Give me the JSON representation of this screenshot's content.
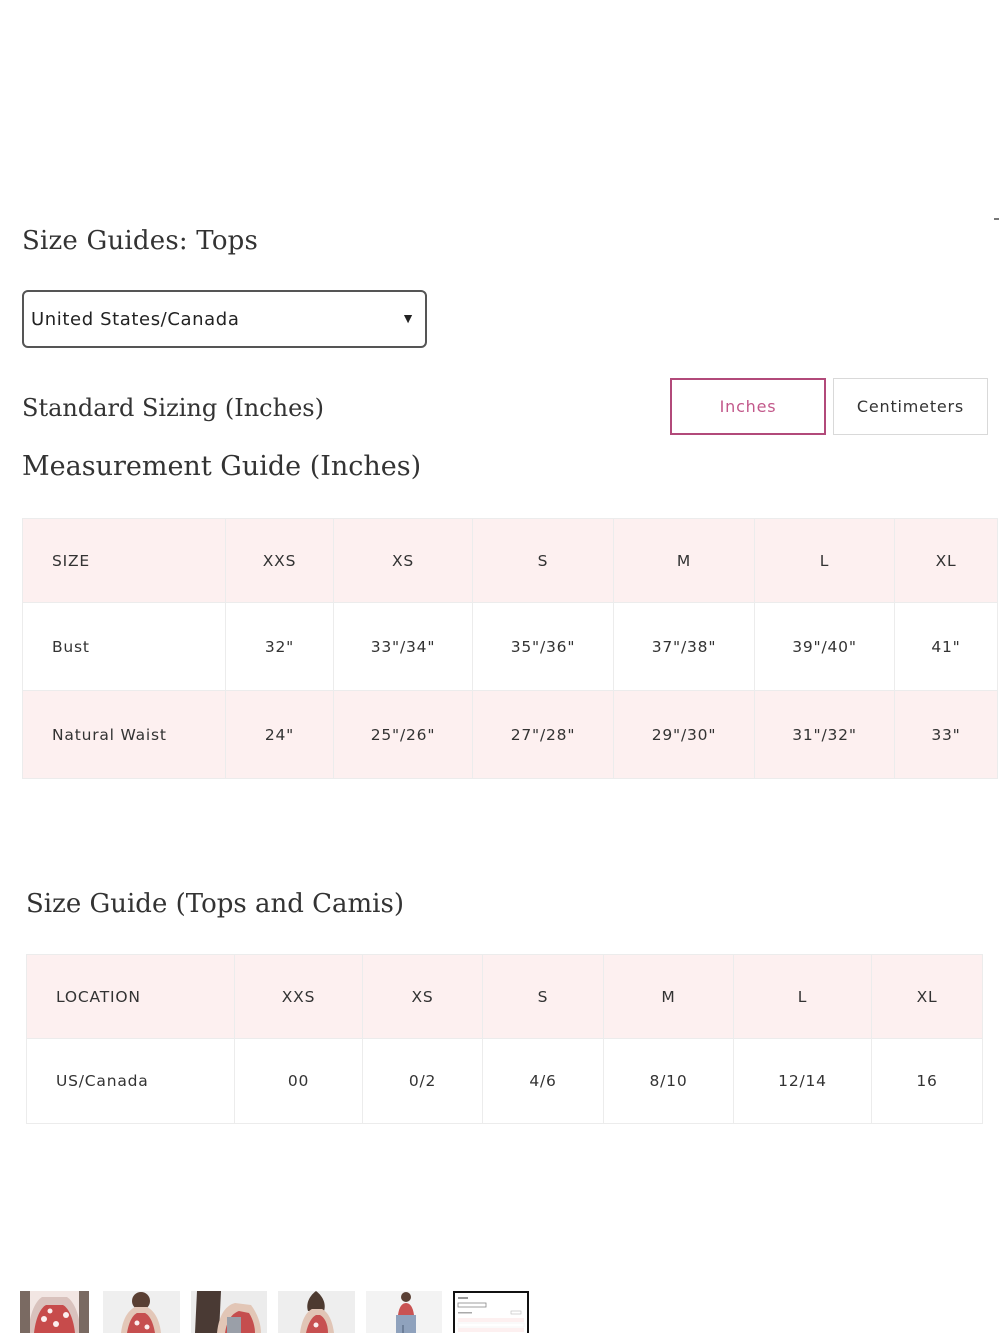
{
  "title": "Size Guides: Tops",
  "region_select": {
    "value": "United States/Canada",
    "caret": "▼"
  },
  "standard_heading": "Standard Sizing (Inches)",
  "unit_toggle": {
    "inches": "Inches",
    "centimeters": "Centimeters",
    "active": "Inches",
    "active_color": "#c2588a"
  },
  "measurement": {
    "heading": "Measurement Guide (Inches)",
    "header": [
      "SIZE",
      "XXS",
      "XS",
      "S",
      "M",
      "L",
      "XL"
    ],
    "rows": [
      [
        "Bust",
        "32\"",
        "33\"/34\"",
        "35\"/36\"",
        "37\"/38\"",
        "39\"/40\"",
        "41\""
      ],
      [
        "Natural Waist",
        "24\"",
        "25\"/26\"",
        "27\"/28\"",
        "29\"/30\"",
        "31\"/32\"",
        "33\""
      ]
    ]
  },
  "size_guide": {
    "heading": "Size Guide (Tops and Camis)",
    "header": [
      "LOCATION",
      "XXS",
      "XS",
      "S",
      "M",
      "L",
      "XL"
    ],
    "rows": [
      [
        "US/Canada",
        "00",
        "0/2",
        "4/6",
        "8/10",
        "12/14",
        "16"
      ]
    ]
  },
  "colors": {
    "header_row_bg": "#fdf0f0",
    "accent": "#c2588a"
  }
}
